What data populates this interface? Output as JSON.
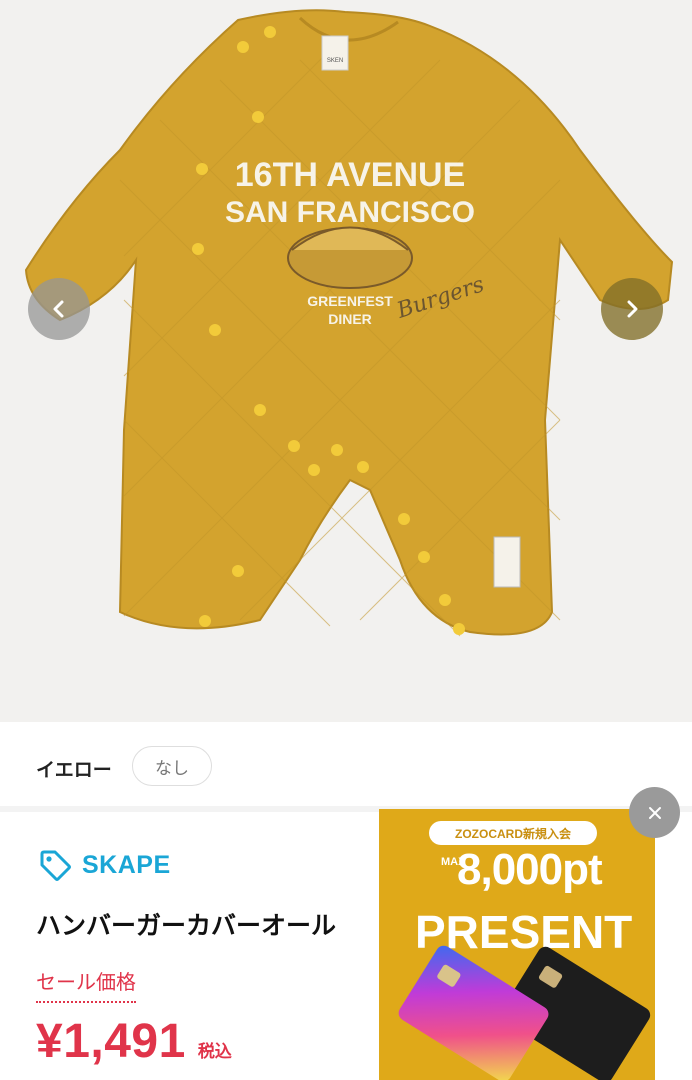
{
  "product_image": {
    "print_top": "16TH AVENUE",
    "print_arc": "SAN FRANCISCO",
    "print_mid": "GREENFEST",
    "print_bottom": "DINER",
    "print_script": "Burgers",
    "neck_label": "SKEN",
    "garment_color": "#d3a32e"
  },
  "variant": {
    "color_name": "イエロー",
    "stock_label": "なし"
  },
  "product": {
    "brand": "SKAPE",
    "name": "ハンバーガーカバーオール",
    "sale_label": "セール価格",
    "price": "¥1,491",
    "tax_label": "税込"
  },
  "ad": {
    "badge": "ZOZOCARD新規入会",
    "max_label": "MAX",
    "points": "8,000pt",
    "headline": "PRESENT",
    "background": "#dfa919"
  },
  "colors": {
    "accent_red": "#e0344a",
    "brand_blue": "#1aa6d6"
  }
}
